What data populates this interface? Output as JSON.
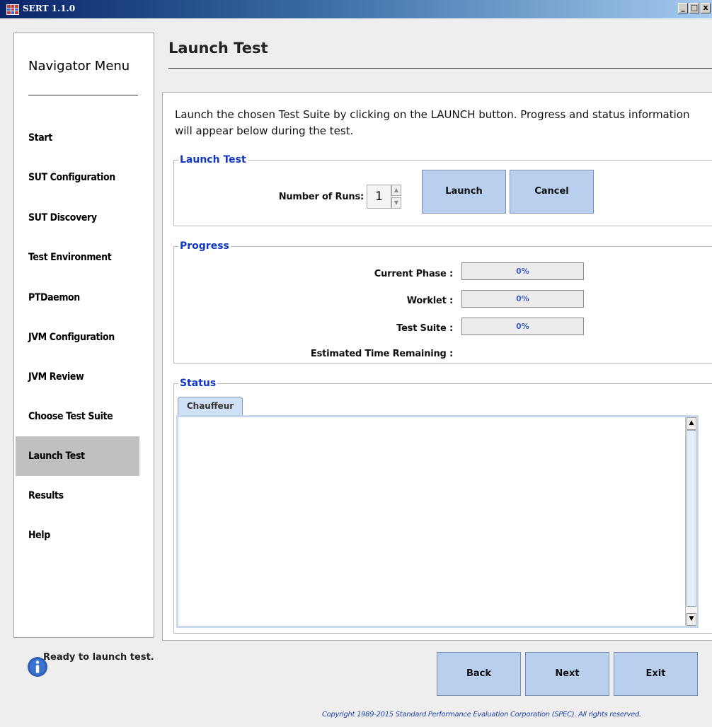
{
  "window": {
    "title": "SERT 1.1.0",
    "controls": [
      "_",
      "□",
      "x"
    ]
  },
  "navigator": {
    "title": "Navigator Menu",
    "items": [
      {
        "label": "Start"
      },
      {
        "label": "SUT Configuration"
      },
      {
        "label": "SUT Discovery"
      },
      {
        "label": "Test Environment"
      },
      {
        "label": "PTDaemon"
      },
      {
        "label": "JVM Configuration"
      },
      {
        "label": "JVM Review"
      },
      {
        "label": "Choose Test Suite"
      },
      {
        "label": "Launch Test",
        "active": true
      },
      {
        "label": "Results"
      },
      {
        "label": "Help"
      }
    ]
  },
  "page": {
    "title": "Launch Test",
    "description": "Launch the chosen Test Suite by clicking on the LAUNCH button.  Progress and status information will appear below during the test."
  },
  "launch_group": {
    "legend": "Launch Test",
    "runs_label": "Number of Runs:",
    "runs_value": "1",
    "launch_label": "Launch",
    "cancel_label": "Cancel"
  },
  "progress_group": {
    "legend": "Progress",
    "current_phase": {
      "label": "Current Phase :",
      "value": "0%",
      "fraction": 0
    },
    "worklet": {
      "label": "Worklet :",
      "value": "0%",
      "fraction": 0
    },
    "test_suite": {
      "label": "Test Suite :",
      "value": "0%",
      "fraction": 0
    },
    "time_remaining": {
      "label": "Estimated Time Remaining :",
      "value": ""
    }
  },
  "status_group": {
    "legend": "Status",
    "tabs": [
      {
        "label": "Chauffeur"
      }
    ],
    "log": ""
  },
  "footer": {
    "status_icon": "info-icon",
    "status_message": "Ready to launch test.",
    "back_label": "Back",
    "next_label": "Next",
    "exit_label": "Exit",
    "copyright": "Copyright 1989-2015 Standard Performance Evaluation Corporation (SPEC). All rights reserved."
  },
  "colors": {
    "accent": "#1036c4",
    "button": "#b8cfee",
    "active_nav": "#c0c0c0"
  }
}
